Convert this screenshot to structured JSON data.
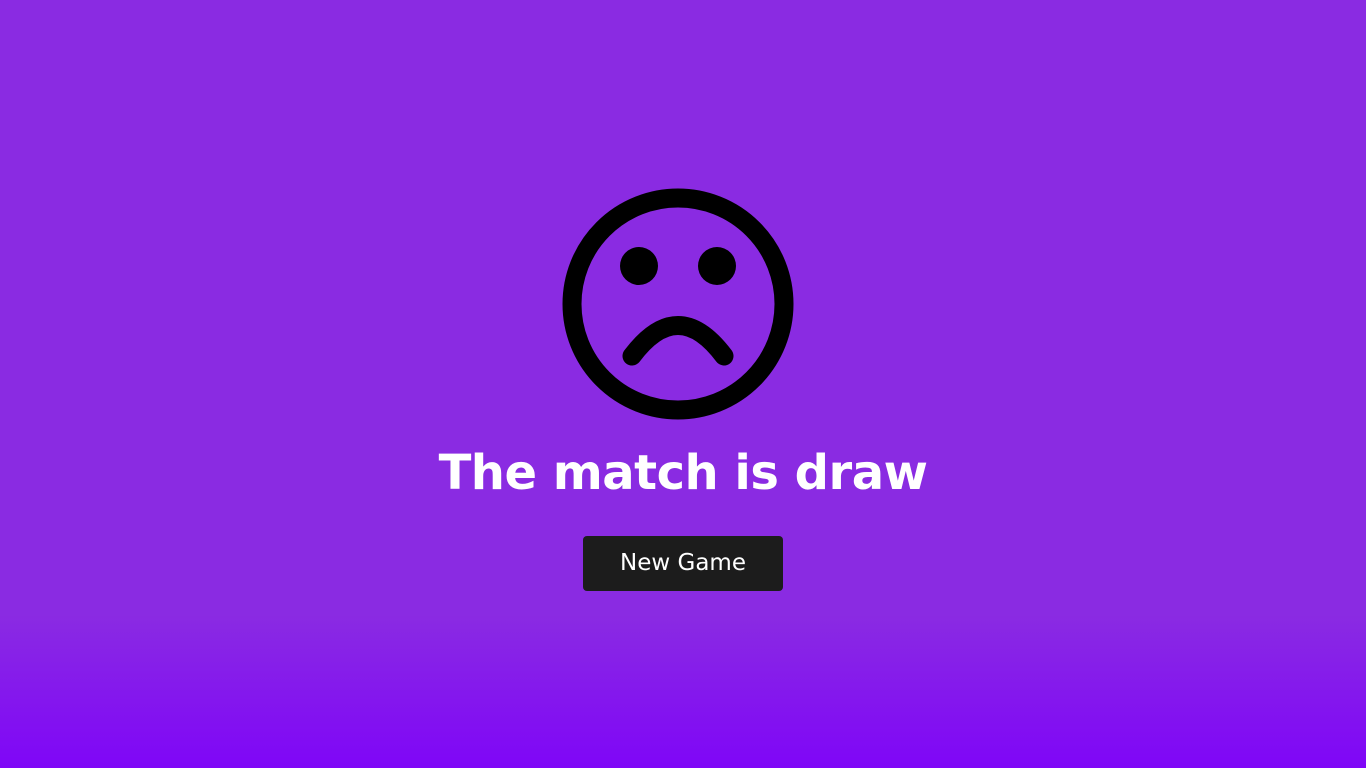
{
  "result": {
    "icon": "sad-face-icon",
    "message": "The match is draw",
    "button_label": "New Game"
  },
  "colors": {
    "background": "#8a2be2",
    "background_bottom": "#7f06f7",
    "text": "#ffffff",
    "button": "#1c1c1c",
    "icon": "#000000"
  }
}
